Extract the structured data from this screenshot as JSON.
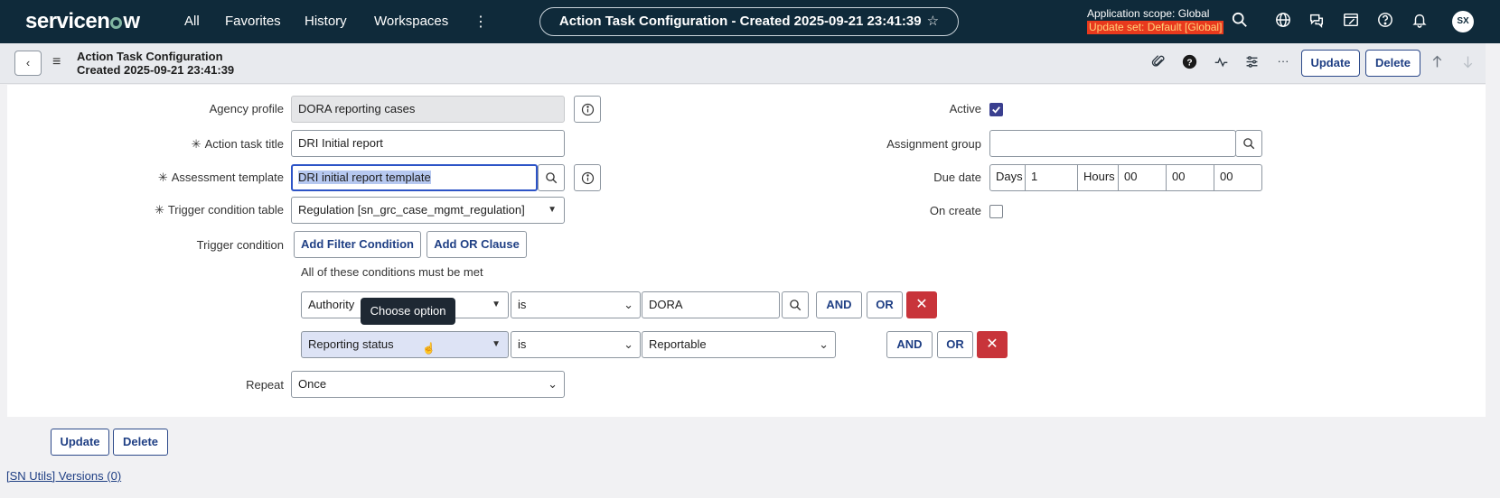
{
  "nav": {
    "logo": "servicenow",
    "links": [
      "All",
      "Favorites",
      "History",
      "Workspaces"
    ],
    "record_title": "Action Task Configuration - Created 2025-09-21 23:41:39",
    "scope_label": "Application scope: Global",
    "update_set": "Update set: Default [Global]",
    "avatar_initials": "SX",
    "icons": [
      "search-icon",
      "globe-icon",
      "chat-icon",
      "studio-icon",
      "help-icon",
      "bell-icon"
    ]
  },
  "header": {
    "title_line1": "Action Task Configuration",
    "title_line2": "Created 2025-09-21 23:41:39",
    "update_label": "Update",
    "delete_label": "Delete",
    "icons": [
      "attachment-icon",
      "question-icon",
      "activity-icon",
      "settings-icon",
      "more-icon",
      "arrow-up-icon",
      "arrow-down-icon"
    ]
  },
  "form": {
    "agency_profile": {
      "label": "Agency profile",
      "value": "DORA reporting cases"
    },
    "action_task_title": {
      "label": "Action task title",
      "value": "DRI Initial report"
    },
    "assessment_template": {
      "label": "Assessment template",
      "value": "DRI initial report template"
    },
    "trigger_condition_table": {
      "label": "Trigger condition table",
      "value": "Regulation [sn_grc_case_mgmt_regulation]"
    },
    "trigger_condition": {
      "label": "Trigger condition",
      "add_filter_label": "Add Filter Condition",
      "add_or_label": "Add OR Clause",
      "conditions_text": "All of these conditions must be met",
      "rows": [
        {
          "field": "Authority",
          "operator": "is",
          "value": "DORA",
          "and": "AND",
          "or": "OR"
        },
        {
          "field": "Reporting status",
          "operator": "is",
          "value": "Reportable",
          "and": "AND",
          "or": "OR"
        }
      ],
      "tooltip": "Choose option"
    },
    "repeat": {
      "label": "Repeat",
      "value": "Once"
    },
    "active": {
      "label": "Active",
      "checked": true
    },
    "assignment_group": {
      "label": "Assignment group",
      "value": ""
    },
    "due_date": {
      "label": "Due date",
      "days_label": "Days",
      "days": "1",
      "hours_label": "Hours",
      "hours": "00",
      "minutes": "00",
      "seconds": "00"
    },
    "on_create": {
      "label": "On create",
      "checked": false
    }
  },
  "footer": {
    "update_label": "Update",
    "delete_label": "Delete",
    "versions_link": "[SN Utils] Versions (0)"
  },
  "colors": {
    "nav_bg": "#0f2a3a",
    "accent": "#1f3f84",
    "danger": "#c8343a",
    "update_set_bg": "#e8391d"
  }
}
